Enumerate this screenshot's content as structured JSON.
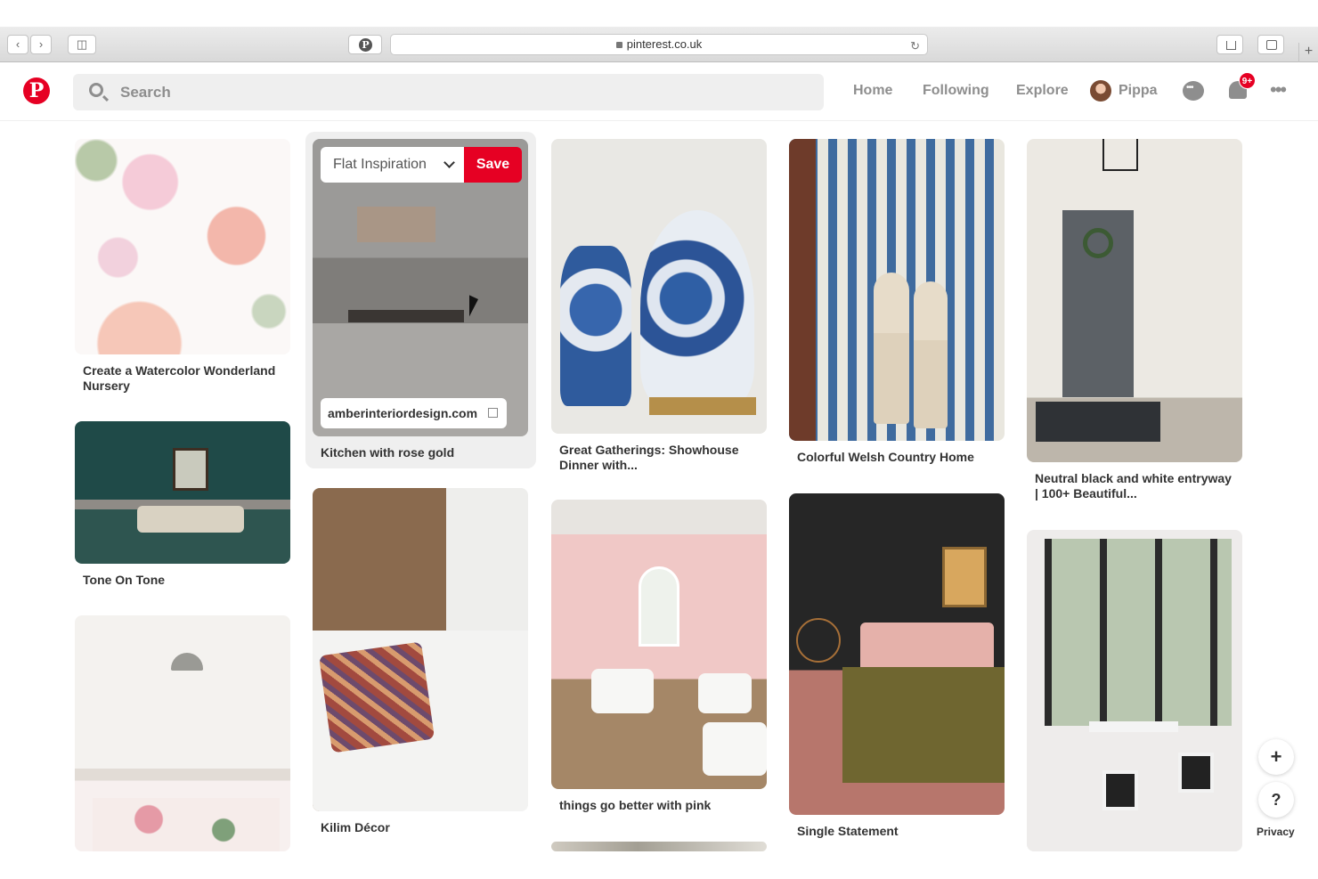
{
  "browser": {
    "url": "pinterest.co.uk"
  },
  "header": {
    "search_placeholder": "Search",
    "nav": [
      "Home",
      "Following",
      "Explore"
    ],
    "user_name": "Pippa",
    "notification_badge": "9+"
  },
  "hover": {
    "board_name": "Flat Inspiration",
    "save_label": "Save",
    "link_domain": "amberinteriordesign.com"
  },
  "pins": [
    {
      "title": "Create a Watercolor Wonderland Nursery"
    },
    {
      "title": "Tone On Tone"
    },
    {
      "title": ""
    },
    {
      "title": "Kitchen with rose gold"
    },
    {
      "title": "Kilim Décor"
    },
    {
      "title": "Great Gatherings: Showhouse Dinner with..."
    },
    {
      "title": "things go better with pink"
    },
    {
      "title": "Colorful Welsh Country Home"
    },
    {
      "title": "Single Statement"
    },
    {
      "title": "Neutral black and white entryway | 100+ Beautiful..."
    },
    {
      "title": ""
    }
  ],
  "footer": {
    "add_label": "+",
    "help_label": "?",
    "privacy_label": "Privacy"
  },
  "colors": {
    "brand_red": "#e60023",
    "text_gray": "#8e8e8e"
  }
}
